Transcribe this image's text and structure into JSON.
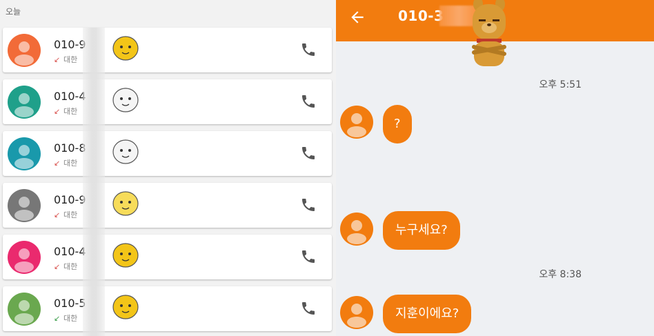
{
  "calllog": {
    "section_label": "오늘",
    "items": [
      {
        "number": "010-9",
        "sub": "대한",
        "avatar_color": "#f26b38",
        "arrow_color": "#d9534f",
        "arrow": "↙"
      },
      {
        "number": "010-4",
        "sub": "대한",
        "avatar_color": "#1fa08a",
        "arrow_color": "#d9534f",
        "arrow": "↙"
      },
      {
        "number": "010-8",
        "sub": "대한",
        "avatar_color": "#1999ab",
        "arrow_color": "#d9534f",
        "arrow": "↙"
      },
      {
        "number": "010-9",
        "sub": "대한",
        "avatar_color": "#777777",
        "arrow_color": "#d9534f",
        "arrow": "↙"
      },
      {
        "number": "010-4",
        "sub": "대한",
        "avatar_color": "#ea2a6e",
        "arrow_color": "#d9534f",
        "arrow": "↙"
      },
      {
        "number": "010-5",
        "sub": "대한",
        "avatar_color": "#6aa84f",
        "arrow_color": "#3a9d4a",
        "arrow": "↙"
      }
    ]
  },
  "chat": {
    "title": "010-3",
    "header_color": "#f27c0f",
    "timestamps": [
      "오후 5:51",
      "오후 8:38"
    ],
    "messages": [
      "?",
      "누구세요?",
      "지훈이에요?"
    ]
  }
}
